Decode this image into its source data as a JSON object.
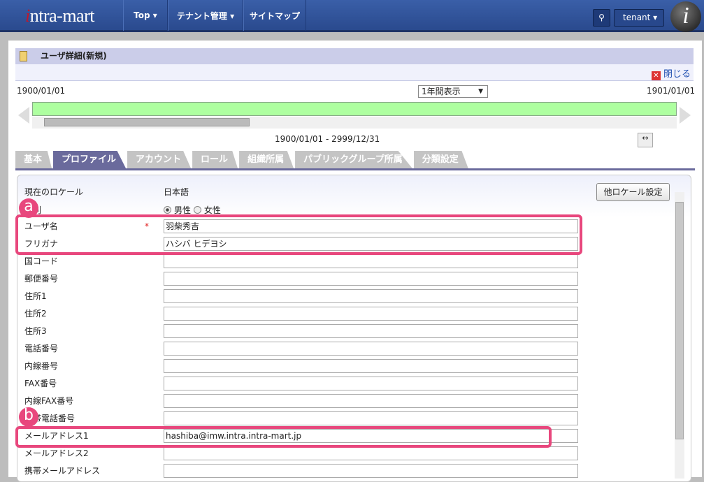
{
  "header": {
    "logo": "intra-mart",
    "nav": [
      {
        "label": "Top ▾"
      },
      {
        "label": "テナント管理 ▾"
      },
      {
        "label": "サイトマップ"
      }
    ],
    "user": "tenant ▾"
  },
  "page": {
    "title": "ユーザ詳細(新規)",
    "close": "閉じる"
  },
  "timeline": {
    "start": "1900/01/01",
    "end": "1901/01/01",
    "view": "1年間表示",
    "range": "1900/01/01 - 2999/12/31"
  },
  "tabs": [
    "基本",
    "プロファイル",
    "アカウント",
    "ロール",
    "組織所属",
    "パブリックグループ所属",
    "分類設定"
  ],
  "form": {
    "locale_label": "現在のロケール",
    "locale_value": "日本語",
    "other_locale_button": "他ロケール設定",
    "gender_label": "性別",
    "gender_options": [
      "男性",
      "女性"
    ],
    "required_mark": "*",
    "rows": [
      {
        "label": "ユーザ名",
        "value": "羽柴秀吉"
      },
      {
        "label": "フリガナ",
        "value": "ハシバ ヒデヨシ"
      },
      {
        "label": "国コード",
        "value": ""
      },
      {
        "label": "郵便番号",
        "value": ""
      },
      {
        "label": "住所1",
        "value": ""
      },
      {
        "label": "住所2",
        "value": ""
      },
      {
        "label": "住所3",
        "value": ""
      },
      {
        "label": "電話番号",
        "value": ""
      },
      {
        "label": "内線番号",
        "value": ""
      },
      {
        "label": "FAX番号",
        "value": ""
      },
      {
        "label": "内線FAX番号",
        "value": ""
      },
      {
        "label": "携帯電話番号",
        "value": ""
      },
      {
        "label": "メールアドレス1",
        "value": "hashiba@imw.intra.intra-mart.jp"
      },
      {
        "label": "メールアドレス2",
        "value": ""
      },
      {
        "label": "携帯メールアドレス",
        "value": ""
      }
    ]
  },
  "annotations": {
    "a": "a",
    "b": "b"
  },
  "colors": {
    "highlight": "#e8477d",
    "header": "#2d4f95",
    "tab_active": "#6a6a9c"
  }
}
